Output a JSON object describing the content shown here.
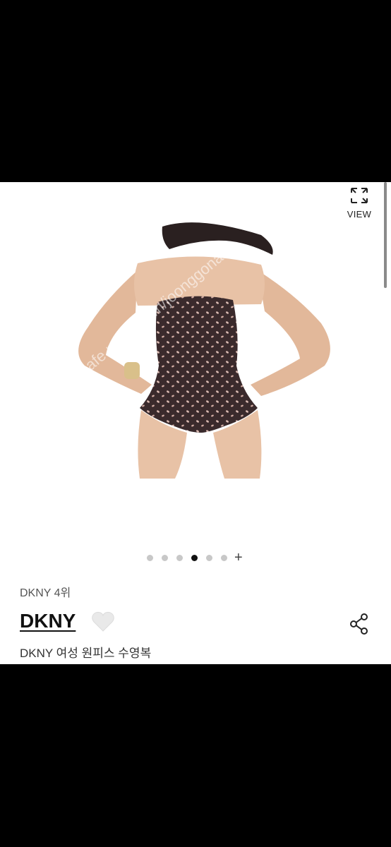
{
  "viewer": {
    "view_label": "VIEW",
    "watermark": "cafe.naver.com/joonggonara"
  },
  "gallery": {
    "dot_count": 6,
    "active_index": 3,
    "more_symbol": "+"
  },
  "product": {
    "brand_rank": "DKNY 4위",
    "brand_name": "DKNY",
    "name": "DKNY 여성 원피스 수영복"
  },
  "colors": {
    "background": "#ffffff",
    "frame": "#000000",
    "text_primary": "#111111",
    "text_secondary": "#555555",
    "dot_inactive": "#c8c8c8",
    "dot_active": "#111111"
  }
}
